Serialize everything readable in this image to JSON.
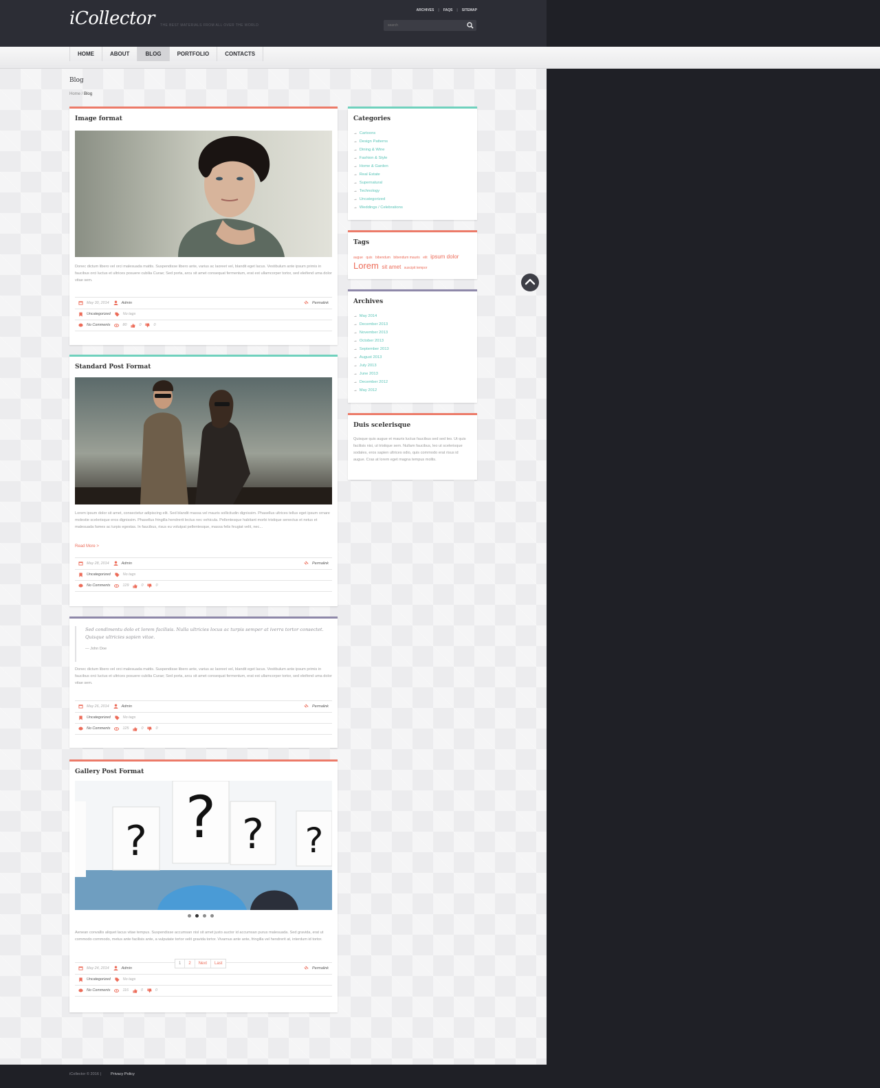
{
  "header": {
    "logo": "iCollector",
    "tagline": "THE BEST MATERIALS FROM ALL OVER THE WORLD",
    "top_links": [
      "ARCHIVES",
      "FAQS",
      "SITEMAP"
    ],
    "search_placeholder": "search"
  },
  "nav": {
    "items": [
      "HOME",
      "ABOUT",
      "BLOG",
      "PORTFOLIO",
      "CONTACTS"
    ],
    "active": "BLOG"
  },
  "page": {
    "title": "Blog",
    "breadcrumb_home": "Home",
    "breadcrumb_sep": " / ",
    "breadcrumb_current": "Blog"
  },
  "posts": [
    {
      "title": "Image format",
      "excerpt": "Donec dictum libero vel orci malesuada mattis. Suspendisse libero ante, varius ac laoreet vel, blandit eget lacus. Vestibulum ante ipsum primis in faucibus orci luctus et ultrices posuere cubilia Curae; Sed porta, arcu sit amet consequat fermentum, erat est ullamcorper tortor, sed eleifend uma dolor vitae sem.",
      "date": "May 30, 2014",
      "author": "Admin",
      "permalink": "Permalink",
      "category": "Uncategorized",
      "tags": "No tags",
      "comments": "No Comments",
      "views": "80",
      "likes": "0",
      "dislikes": "0"
    },
    {
      "title": "Standard Post Format",
      "excerpt": "Lorem ipsum dolor sit amet, consectetur adipiscing elit. Sed blandit massa vel mauris sollicitudin dignissim. Phasellus ultrices tellus eget ipsum ornare molestie scelerisque eros dignissim. Phasellus fringilla hendrerit lectus nec vehicula. Pellentesque habitant morbi tristique senectus et netus et malesuada fames ac turpis egestas. In faucibus, risus eu volutpat pellentesque, massa felis feugiat velit, nec...",
      "read_more": "Read More >",
      "date": "May 28, 2014",
      "author": "Admin",
      "permalink": "Permalink",
      "category": "Uncategorized",
      "tags": "No tags",
      "comments": "No Comments",
      "views": "129",
      "likes": "0",
      "dislikes": "0"
    },
    {
      "quote": "Sed condimentu dolo et lorem facilisis. Nulla ultricies locus ac turpis semper at iverra tortor consectet. Quisque ultricies sapien vitae.",
      "quote_author": "— John Doe",
      "excerpt": "Donec dictum libero vel orci malesuada mattis. Suspendisse libero ante, varius ac laoreet vel, blandit eget lacus. Vestibulum ante ipsum primis in faucibus orci luctus et ultrices posuere cubilia Curae; Sed porta, arcu sit amet consequat fermentum, erat est ullamcorper tortor, sed eleifend uma dolor vitae sem.",
      "date": "May 26, 2014",
      "author": "Admin",
      "permalink": "Permalink",
      "category": "Uncategorized",
      "tags": "No tags",
      "comments": "No Comments",
      "views": "125",
      "likes": "0",
      "dislikes": "0"
    },
    {
      "title": "Gallery Post Format",
      "excerpt": "Aenean convallis aliquet lacus vitae tempus. Suspendisse accumsan nisl sit amet justo auctor id accumsan purus malesuada. Sed gravida, erat ut commodo commodo, metus ante facilisis ante, a vulputate tortor velit gravida tortor. Vivamus ante ante, fringilla vel hendrerit at, interdum id tortor.",
      "date": "May 24, 2014",
      "author": "Admin",
      "permalink": "Permalink",
      "category": "Uncategorized",
      "tags": "No tags",
      "comments": "No Comments",
      "views": "116",
      "likes": "0",
      "dislikes": "0",
      "slides": 4,
      "active_slide": 2
    }
  ],
  "sidebar": {
    "categories_title": "Categories",
    "categories": [
      "Cartoons",
      "Design Patterns",
      "Dining & Wine",
      "Fashion & Style",
      "Home & Garden",
      "Real Estate",
      "Supernatural",
      "Technology",
      "Uncategorized",
      "Weddings / Celebrations"
    ],
    "tags_title": "Tags",
    "tags": [
      {
        "text": "augue",
        "size": 5
      },
      {
        "text": "quis",
        "size": 5
      },
      {
        "text": "bibendum",
        "size": 5
      },
      {
        "text": "bibendum mauris",
        "size": 5
      },
      {
        "text": "elit",
        "size": 5
      },
      {
        "text": "ipsum dolor",
        "size": 8
      },
      {
        "text": "Lorem",
        "size": 13
      },
      {
        "text": "sit amet",
        "size": 8
      },
      {
        "text": "suscipit tempor",
        "size": 5
      }
    ],
    "archives_title": "Archives",
    "archives": [
      "May 2014",
      "December 2013",
      "November 2013",
      "October 2013",
      "September 2013",
      "August 2013",
      "July 2013",
      "June 2013",
      "December 2012",
      "May 2012"
    ],
    "about_title": "Duis scelerisque",
    "about_text": "Quisque quis augue et mauris luctus faucibus sed sed leo. Ut quis facilisis nisi, ut tristique sem. Nullam faucibus, leo ut scelerisque sodales, eros sapien ultrices odio, quis commodo erat risus id augue. Cras at lorem eget magna tempus mollis."
  },
  "pagination": [
    "1",
    "2",
    "Next",
    "Last"
  ],
  "footer": {
    "copyright": "iCollector © 2016",
    "sep": "|",
    "policy": "Privacy Policy"
  },
  "colors": {
    "accent": "#ec6b58",
    "teal": "#57c3b6",
    "header_bg": "#2c2d35",
    "dark_bg": "#1f2026"
  }
}
